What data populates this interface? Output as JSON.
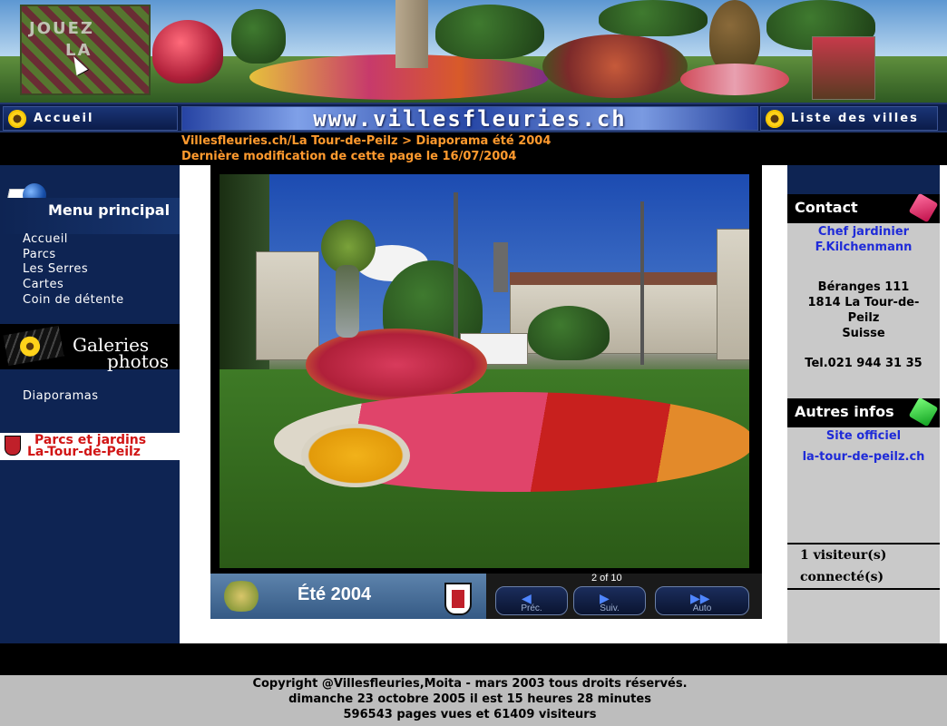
{
  "banner": {
    "sign_text_1": "JOUEZ",
    "sign_text_2": "LA"
  },
  "nav": {
    "home_label": "Accueil",
    "site_url": "www.villesfleuries.ch",
    "cities_label": "Liste des villes"
  },
  "breadcrumb": {
    "path": "Villesfleuries.ch/La Tour-de-Peilz > Diaporama été 2004",
    "last_modified": "Dernière modification de cette page le 16/07/2004"
  },
  "left_menu": {
    "main_title": "Menu principal",
    "items": [
      "Accueil",
      "Parcs",
      "Les Serres",
      "Cartes",
      "Coin de détente"
    ],
    "gallery_title_1": "Galeries",
    "gallery_title_2": "photos",
    "gallery_items": [
      "Diaporamas"
    ],
    "parcs_banner_1": "Parcs et jardins",
    "parcs_banner_2": "La-Tour-de-Peilz"
  },
  "slideshow": {
    "title": "Été 2004",
    "counter": "2 of 10",
    "prev_label": "Préc.",
    "next_label": "Suiv.",
    "auto_label": "Auto"
  },
  "right_panel": {
    "contact_title": "Contact",
    "contact_role": "Chef jardinier",
    "contact_name": "F.Kilchenmann",
    "address_1": "Béranges 111",
    "address_2": "1814 La Tour-de-",
    "address_3": "Peilz",
    "address_4": "Suisse",
    "phone": "Tel.021 944 31 35",
    "other_title": "Autres infos",
    "official_label": "Site officiel",
    "official_link": "la-tour-de-peilz.ch",
    "visitors_line_1": "1 visiteur(s)",
    "visitors_line_2": "connecté(s)"
  },
  "footer": {
    "line_1": "Copyright @Villesfleuries,Moita - mars 2003 tous droits réservés.",
    "line_2": "dimanche 23 octobre 2005 il est 15 heures 28 minutes",
    "line_3": "596543 pages vues et 61409 visiteurs"
  },
  "colors": {
    "nav_dark": "#0c1d4a",
    "breadcrumb_orange": "#ff9a2e",
    "link_blue": "#1f2bd8",
    "banner_red": "#d11515",
    "panel_grey": "#c9c9c9"
  }
}
